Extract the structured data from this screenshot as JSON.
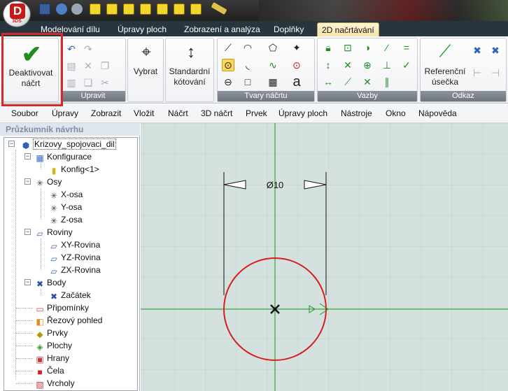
{
  "app": {
    "logo_letter": "D",
    "logo_sub": "3DS"
  },
  "ribbon_tabs": [
    {
      "label": "Modelování dílu"
    },
    {
      "label": "Úpravy ploch"
    },
    {
      "label": "Zobrazení a analýza"
    },
    {
      "label": "Doplňky"
    },
    {
      "label": "2D načrtávání",
      "active": true
    }
  ],
  "ribbon": {
    "deactivate_label_1": "Deaktivovat",
    "deactivate_label_2": "náčrt",
    "edit_group_label": "Upravit",
    "select_label": "Vybrat",
    "std_dim_label_1": "Standardní",
    "std_dim_label_2": "kótování",
    "shapes_group_label": "Tvary náčrtu",
    "constraints_group_label": "Vazby",
    "reference_label_1": "Referenční",
    "reference_label_2": "úsečka",
    "reference_group_label": "Odkaz"
  },
  "menu": [
    "Soubor",
    "Úpravy",
    "Zobrazit",
    "Vložit",
    "Náčrt",
    "3D náčrt",
    "Prvek",
    "Úpravy ploch",
    "Nástroje",
    "Okno",
    "Nápověda"
  ],
  "panel_title": "Průzkumník návrhu",
  "tree": {
    "root": "Krizovy_spojovaci_dil",
    "configurations": "Konfigurace",
    "config1": "Konfig<1>",
    "axes": "Osy",
    "x_axis": "X-osa",
    "y_axis": "Y-osa",
    "z_axis": "Z-osa",
    "planes": "Roviny",
    "xy_plane": "XY-Rovina",
    "yz_plane": "YZ-Rovina",
    "zx_plane": "ZX-Rovina",
    "points": "Body",
    "origin": "Začátek",
    "comments": "Připomínky",
    "section_view": "Řezový pohled",
    "features": "Prvky",
    "surfaces": "Plochy",
    "edges": "Hrany",
    "faces": "Čela",
    "vertices": "Vrcholy"
  },
  "canvas": {
    "dimension_text": "Ø10",
    "circle_diameter": 10,
    "colors": {
      "circle": "#d62020",
      "axes": "#1a9a1a",
      "background": "#d4e1df",
      "grid": "#c2d1ce"
    }
  }
}
